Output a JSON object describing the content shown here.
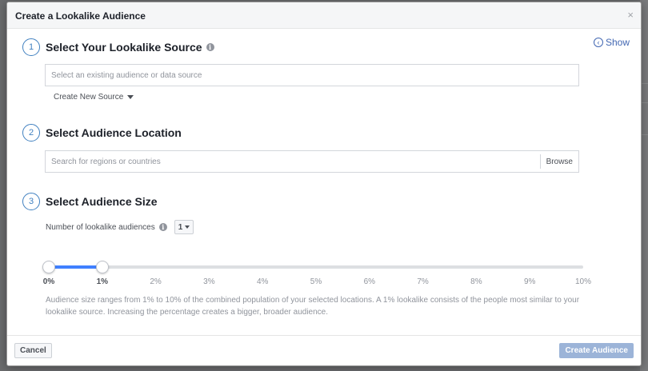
{
  "dialog": {
    "title": "Create a Lookalike Audience",
    "close_glyph": "×",
    "show_label": "Show",
    "show_icon": "chevron-left-icon"
  },
  "steps": [
    {
      "number": "1",
      "title": "Select Your Lookalike Source",
      "has_info": true
    },
    {
      "number": "2",
      "title": "Select Audience Location",
      "has_info": false
    },
    {
      "number": "3",
      "title": "Select Audience Size",
      "has_info": false
    }
  ],
  "source": {
    "placeholder": "Select an existing audience or data source",
    "create_new_label": "Create New Source"
  },
  "location": {
    "placeholder": "Search for regions or countries",
    "browse_label": "Browse"
  },
  "size": {
    "number_label": "Number of lookalike audiences",
    "number_value": "1",
    "slider": {
      "min_percent": 0,
      "max_percent": 10,
      "range_start_percent": 0,
      "range_end_percent": 1,
      "ticks": [
        "0%",
        "1%",
        "2%",
        "3%",
        "4%",
        "5%",
        "6%",
        "7%",
        "8%",
        "9%",
        "10%"
      ],
      "fill_color": "#4080ff"
    },
    "description": "Audience size ranges from 1% to 10% of the combined population of your selected locations. A 1% lookalike consists of the people most similar to your lookalike source. Increasing the percentage creates a bigger, broader audience."
  },
  "footer": {
    "cancel_label": "Cancel",
    "create_label": "Create Audience"
  }
}
